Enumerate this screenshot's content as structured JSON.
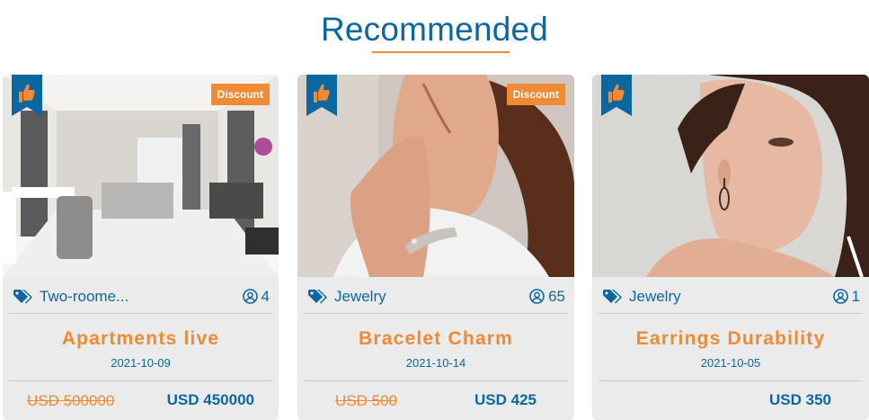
{
  "section": {
    "title": "Recommended"
  },
  "cards": [
    {
      "category": "Two-roome...",
      "views": "4",
      "title": "Apartments live",
      "date": "2021-10-09",
      "old_price": "USD 500000",
      "new_price": "USD 450000",
      "badge": "Discount",
      "image_subject": "apartment-living-room-photo"
    },
    {
      "category": "Jewelry",
      "views": "65",
      "title": "Bracelet Charm",
      "date": "2021-10-14",
      "old_price": "USD 500",
      "new_price": "USD 425",
      "badge": "Discount",
      "image_subject": "woman-wearing-bracelet-photo"
    },
    {
      "category": "Jewelry",
      "views": "1",
      "title": "Earrings Durability",
      "date": "2021-10-05",
      "new_price": "USD 350",
      "image_subject": "woman-wearing-earrings-photo"
    }
  ],
  "colors": {
    "primary": "#0b67a0",
    "accent": "#f08a34",
    "card_bg": "#ebebeb"
  },
  "icons": {
    "ribbon": "thumbs-up-ribbon-icon",
    "category": "tag-icon",
    "views": "user-circle-icon"
  }
}
